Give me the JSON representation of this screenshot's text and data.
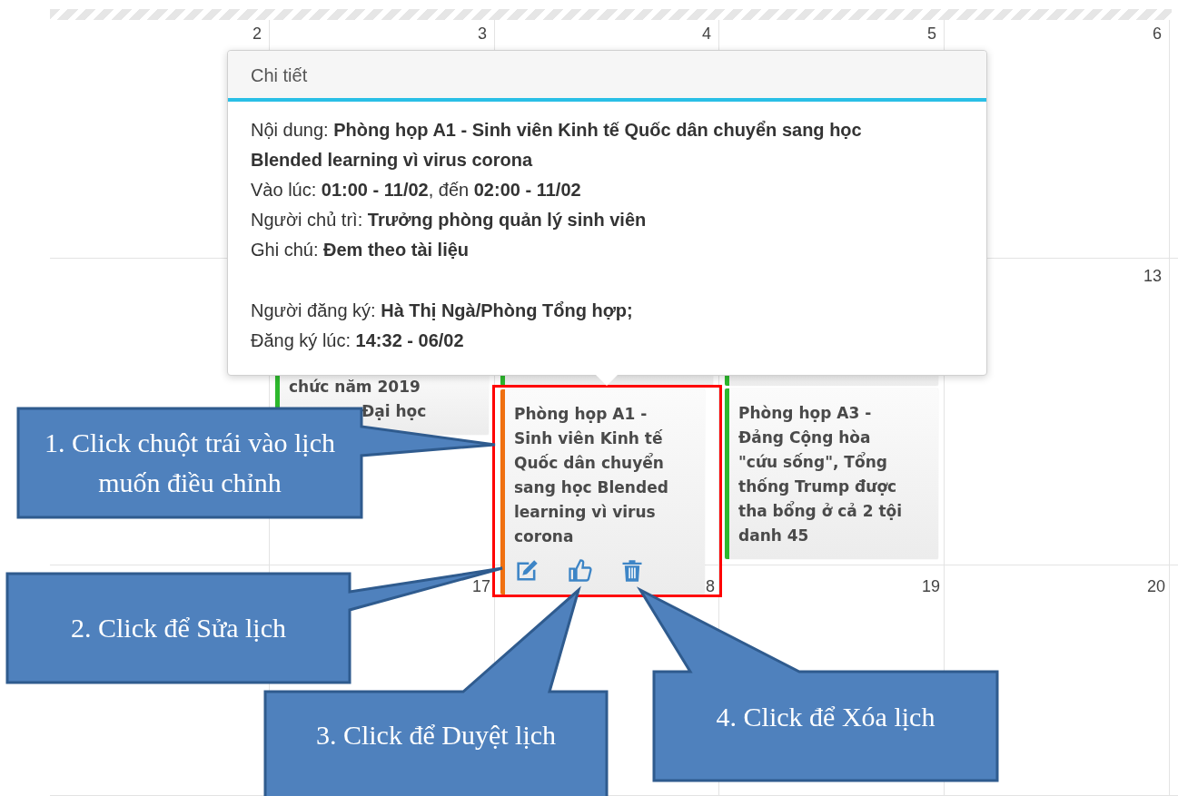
{
  "calendar": {
    "weeks": [
      {
        "days": [
          {
            "number": "2"
          },
          {
            "number": "3"
          },
          {
            "number": "4"
          },
          {
            "number": "5"
          },
          {
            "number": "6"
          }
        ]
      },
      {
        "days": [
          {
            "events": [
              {
                "kind": "card",
                "color": "#2db82d",
                "selected": false,
                "partly_covered": true,
                "lines": [
                  "chức năm 2019",
                  "Đại học"
                ]
              }
            ]
          },
          {
            "events": [
              {
                "kind": "stub",
                "color": "#2db82d",
                "selected": false
              },
              {
                "kind": "card",
                "color": "#f07010",
                "selected": true,
                "lines": [
                  "Phòng họp A1 - Sinh viên Kinh tế Quốc dân chuyển sang học Blended learning vì virus corona"
                ],
                "actions": [
                  {
                    "kind": "edit"
                  },
                  {
                    "kind": "approve"
                  },
                  {
                    "kind": "delete"
                  }
                ]
              }
            ]
          },
          {
            "events": [
              {
                "kind": "stub",
                "color": "#2db82d",
                "selected": false
              },
              {
                "kind": "card",
                "color": "#2db82d",
                "selected": false,
                "lines": [
                  "Phòng họp A3 - Đảng Cộng hòa \"cứu sống\", Tổng thống Trump được tha bổng ở cả 2 tội danh 45"
                ]
              }
            ]
          },
          {
            "number": "13"
          }
        ]
      },
      {
        "days": [
          {
            "number": "17"
          },
          {
            "number": "8"
          },
          {
            "number": "19"
          },
          {
            "number": "20"
          }
        ]
      }
    ]
  },
  "popover": {
    "title": "Chi tiết",
    "lines": [
      {
        "text": "Nội dung: **Phòng họp A1 - Sinh viên Kinh tế Quốc dân chuyển sang học Blended learning vì virus corona**",
        "gap_before": false
      },
      {
        "text": "Vào lúc: **01:00 - 11/02**, đến **02:00 - 11/02**",
        "gap_before": false
      },
      {
        "text": "Người chủ trì: **Trưởng phòng quản lý sinh viên**",
        "gap_before": false
      },
      {
        "text": "Ghi chú: **Đem theo tài liệu**",
        "gap_before": false
      },
      {
        "text": "Người đăng ký: **Hà Thị Ngà/Phòng Tổng hợp;**",
        "gap_before": true
      },
      {
        "text": "Đăng ký lúc: **14:32 - 06/02**",
        "gap_before": false
      }
    ]
  },
  "callouts": [
    {
      "text": "1. Click chuột trái vào lịch muốn điều chỉnh"
    },
    {
      "text": "2. Click để Sửa lịch"
    },
    {
      "text": "3. Click để Duyệt lịch"
    },
    {
      "text": "4. Click để Xóa lịch"
    }
  ]
}
